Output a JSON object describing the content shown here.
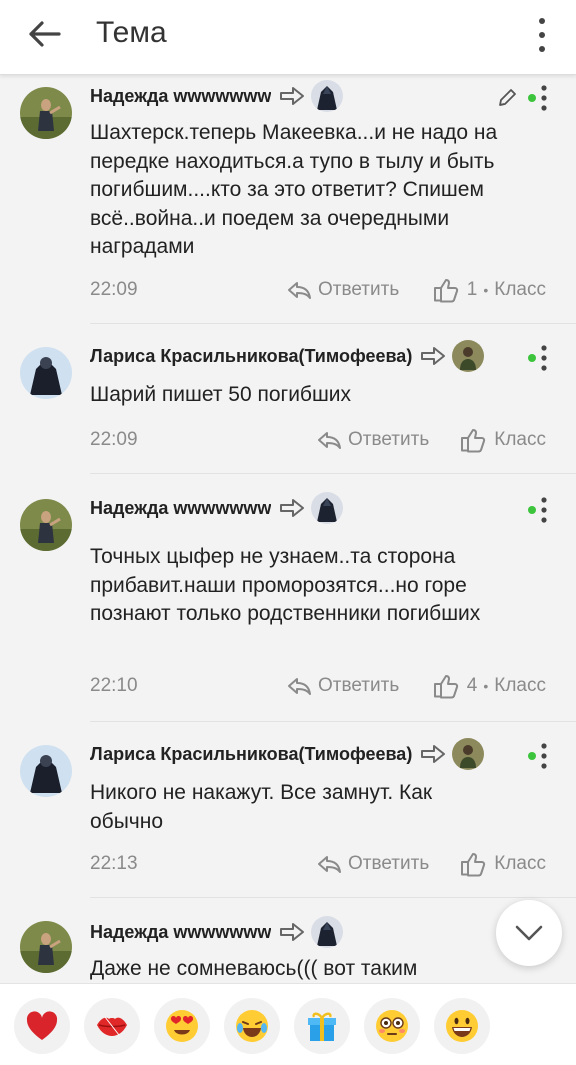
{
  "header": {
    "title": "Тема"
  },
  "comments": [
    {
      "name": "Надежда wwwwwww",
      "text": "Шахтерск.теперь Макеевка...и не надо на передке находиться.а тупо в тылу и быть погибшим....кто за это ответит? Спишем всё..война..и поедем за очередными наградами",
      "time": "22:09",
      "reply": "Ответить",
      "like_count": "1",
      "like_dot": "•",
      "like_label": "Класс"
    },
    {
      "name": "Лариса Красильникова(Тимофеева)",
      "text": "Шарий пишет 50 погибших",
      "time": "22:09",
      "reply": "Ответить",
      "like_count": "",
      "like_dot": "",
      "like_label": "Класс"
    },
    {
      "name": "Надежда wwwwwww",
      "text": "Точных цыфер не узнаем..та сторона прибавит.наши проморозятся...но горе познают только родственники погибших",
      "time": "22:10",
      "reply": "Ответить",
      "like_count": "4",
      "like_dot": "•",
      "like_label": "Класс"
    },
    {
      "name": "Лариса Красильникова(Тимофеева)",
      "text": "Никого не накажут. Все замнут. Как обычно",
      "time": "22:13",
      "reply": "Ответить",
      "like_count": "",
      "like_dot": "",
      "like_label": "Класс"
    },
    {
      "name": "Надежда wwwwwww",
      "text": "Даже не сомневаюсь((( вот таким"
    }
  ],
  "reactions": [
    "❤️",
    "💋",
    "😍",
    "😂",
    "🎁",
    "😳",
    "😀"
  ],
  "colors": {
    "online": "#3cc43c",
    "accent_text": "#8a8a8a"
  }
}
